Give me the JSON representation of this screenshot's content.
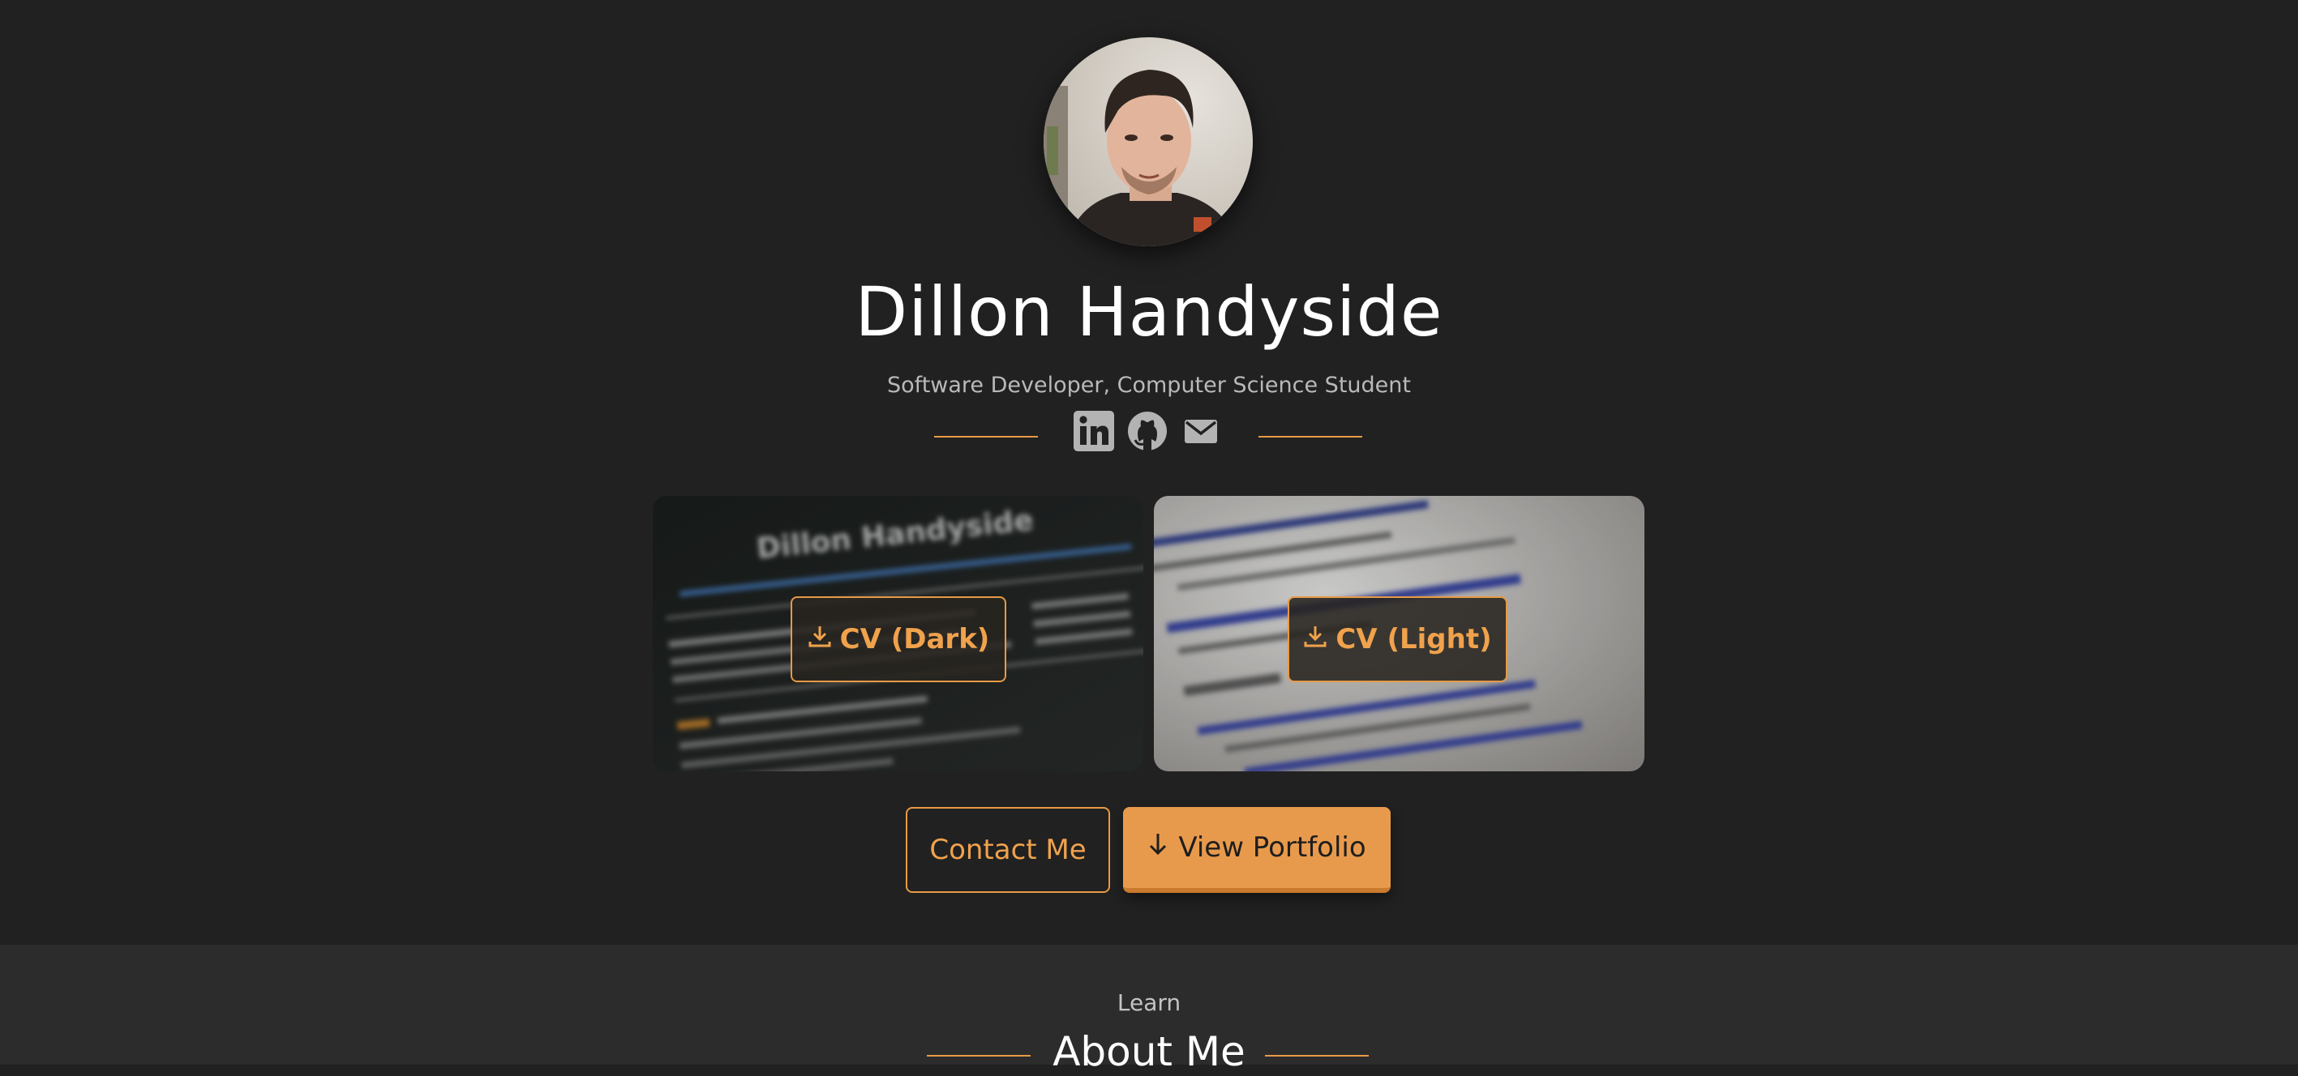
{
  "profile": {
    "name": "Dillon Handyside",
    "tagline": "Software Developer, Computer Science Student"
  },
  "socials": [
    {
      "icon": "linkedin-icon"
    },
    {
      "icon": "github-icon"
    },
    {
      "icon": "mail-icon"
    }
  ],
  "cv": {
    "dark_label": "CV (Dark)",
    "light_label": "CV (Light)",
    "dark_preview_title": "Dillon Handyside"
  },
  "actions": {
    "contact_label": "Contact Me",
    "portfolio_label": "View Portfolio"
  },
  "about": {
    "kicker": "Learn",
    "title": "About Me"
  },
  "colors": {
    "background": "#212121",
    "section_background": "#2c2c2c",
    "accent": "#e89a45"
  }
}
